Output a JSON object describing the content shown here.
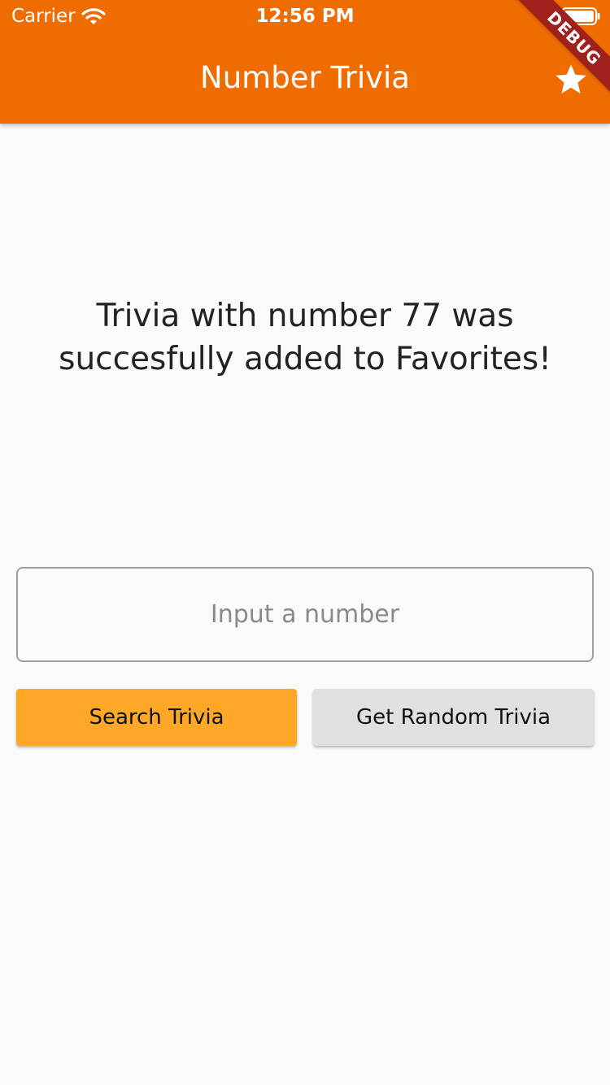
{
  "status_bar": {
    "carrier": "Carrier",
    "time": "12:56 PM"
  },
  "app_bar": {
    "title": "Number Trivia",
    "action_icon": "star-icon",
    "debug_label": "DEBUG"
  },
  "main": {
    "message": "Trivia with number 77 was succesfully added to Favorites!",
    "input": {
      "placeholder": "Input a number",
      "value": ""
    },
    "buttons": {
      "search_label": "Search Trivia",
      "random_label": "Get Random Trivia"
    }
  },
  "colors": {
    "app_bar": "#ef6c00",
    "search_button": "#ffa726",
    "random_button": "#e0e0e0",
    "debug_banner": "#a0201c",
    "background": "#fafafa"
  }
}
